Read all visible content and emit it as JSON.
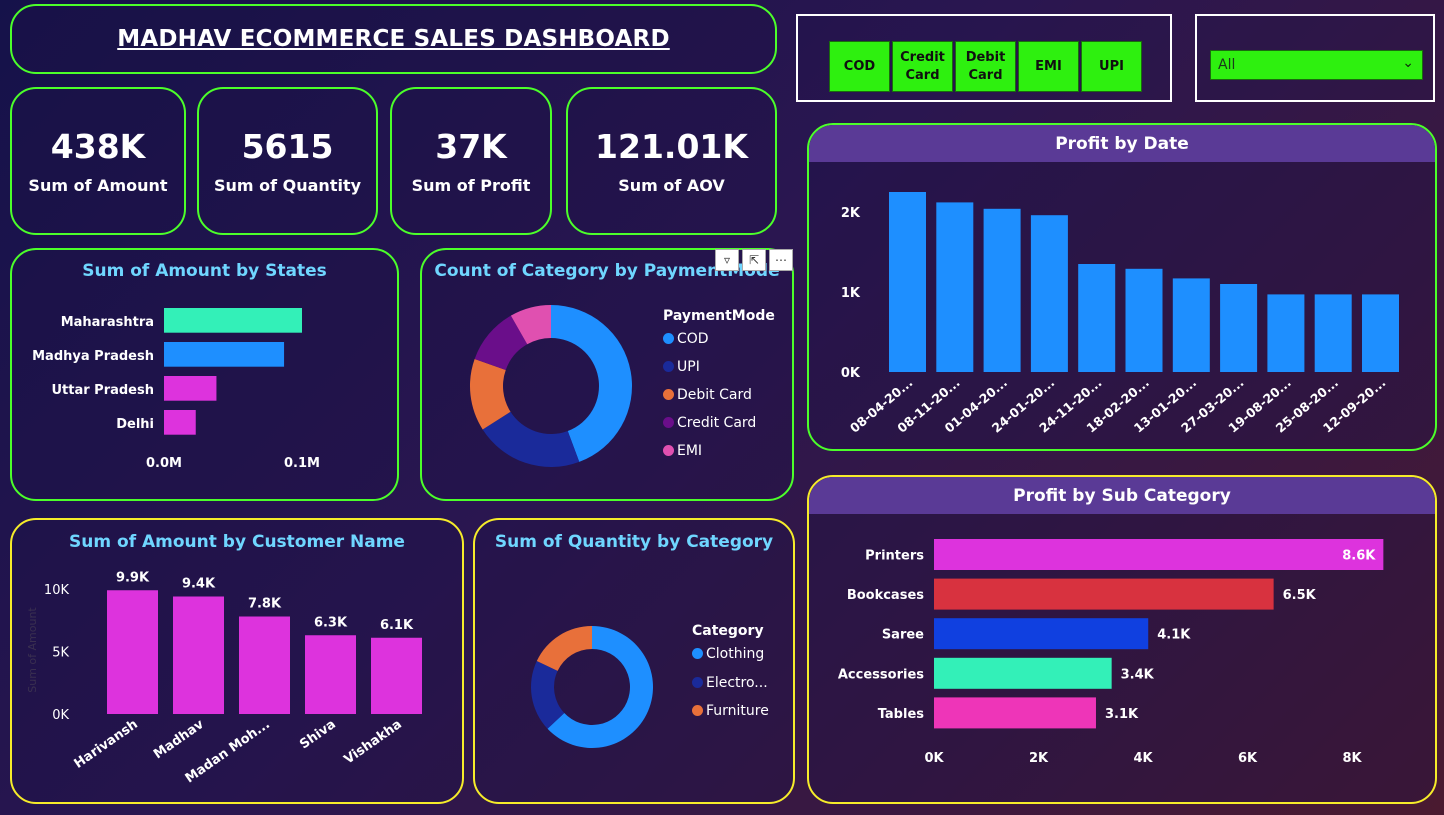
{
  "dashboard": {
    "title": "MADHAV ECOMMERCE SALES DASHBOARD"
  },
  "kpis": [
    {
      "value": "438K",
      "label": "Sum of Amount"
    },
    {
      "value": "5615",
      "label": "Sum of Quantity"
    },
    {
      "value": "37K",
      "label": "Sum of Profit"
    },
    {
      "value": "121.01K",
      "label": "Sum of AOV"
    }
  ],
  "payment_slicer": {
    "buttons": [
      "COD",
      "Credit\nCard",
      "Debit\nCard",
      "EMI",
      "UPI"
    ]
  },
  "dropdown_slicer": {
    "selected": "All"
  },
  "colors": {
    "accent_green": "#4cff2a",
    "accent_yellow": "#f6ec2a",
    "blue": "#1e8fff",
    "magenta": "#dd33dd",
    "teal": "#33f0b8",
    "navy": "#1a2a9a",
    "orange": "#e8703a",
    "purple": "#6a0e8a",
    "pink": "#e050b0"
  },
  "chart_data": [
    {
      "type": "bar",
      "orientation": "horizontal",
      "title": "Sum of Amount by States",
      "categories": [
        "Maharashtra",
        "Madhya Pradesh",
        "Uttar Pradesh",
        "Delhi"
      ],
      "values": [
        0.1,
        0.087,
        0.038,
        0.023
      ],
      "colors": [
        "#33f0b8",
        "#1e8fff",
        "#dd33dd",
        "#dd33dd"
      ],
      "x_ticks": [
        "0.0M",
        "0.1M"
      ],
      "xlim": [
        0,
        0.1
      ]
    },
    {
      "type": "pie",
      "donut": true,
      "title": "Count of Category by PaymentMode",
      "legend_title": "PaymentMode",
      "categories": [
        "COD",
        "UPI",
        "Debit Card",
        "Credit Card",
        "EMI"
      ],
      "values": [
        43,
        21,
        14,
        11,
        8
      ],
      "colors": [
        "#1e8fff",
        "#1a2a9a",
        "#e8703a",
        "#6a0e8a",
        "#e050b0"
      ]
    },
    {
      "type": "bar",
      "title": "Profit by Date",
      "categories": [
        "08-04-20...",
        "08-11-20...",
        "01-04-20...",
        "24-01-20...",
        "24-11-20...",
        "18-02-20...",
        "13-01-20...",
        "27-03-20...",
        "19-08-20...",
        "25-08-20...",
        "12-09-20..."
      ],
      "values": [
        2250,
        2120,
        2040,
        1960,
        1350,
        1290,
        1170,
        1100,
        970,
        970,
        970
      ],
      "y_ticks": [
        "0K",
        "1K",
        "2K"
      ],
      "ylim": [
        0,
        2500
      ]
    },
    {
      "type": "bar",
      "title": "Sum of Amount by Customer Name",
      "ylabel": "Sum of Amount",
      "categories": [
        "Harivansh",
        "Madhav",
        "Madan Moh...",
        "Shiva",
        "Vishakha"
      ],
      "values": [
        9900,
        9400,
        7800,
        6300,
        6100
      ],
      "data_labels": [
        "9.9K",
        "9.4K",
        "7.8K",
        "6.3K",
        "6.1K"
      ],
      "y_ticks": [
        "0K",
        "5K",
        "10K"
      ],
      "ylim": [
        0,
        10000
      ]
    },
    {
      "type": "pie",
      "donut": true,
      "title": "Sum of Quantity by Category",
      "legend_title": "Category",
      "categories": [
        "Clothing",
        "Electro...",
        "Furniture"
      ],
      "values": [
        63,
        19,
        18
      ],
      "colors": [
        "#1e8fff",
        "#1a2a9a",
        "#e8703a"
      ]
    },
    {
      "type": "bar",
      "orientation": "horizontal",
      "title": "Profit by Sub Category",
      "categories": [
        "Printers",
        "Bookcases",
        "Saree",
        "Accessories",
        "Tables"
      ],
      "values": [
        8600,
        6500,
        4100,
        3400,
        3100
      ],
      "data_labels": [
        "8.6K",
        "6.5K",
        "4.1K",
        "3.4K",
        "3.1K"
      ],
      "colors": [
        "#dd33dd",
        "#d8323f",
        "#1040e0",
        "#33f0b8",
        "#ee35b8"
      ],
      "x_ticks": [
        "0K",
        "2K",
        "4K",
        "6K",
        "8K"
      ],
      "xlim": [
        0,
        8000
      ]
    }
  ]
}
